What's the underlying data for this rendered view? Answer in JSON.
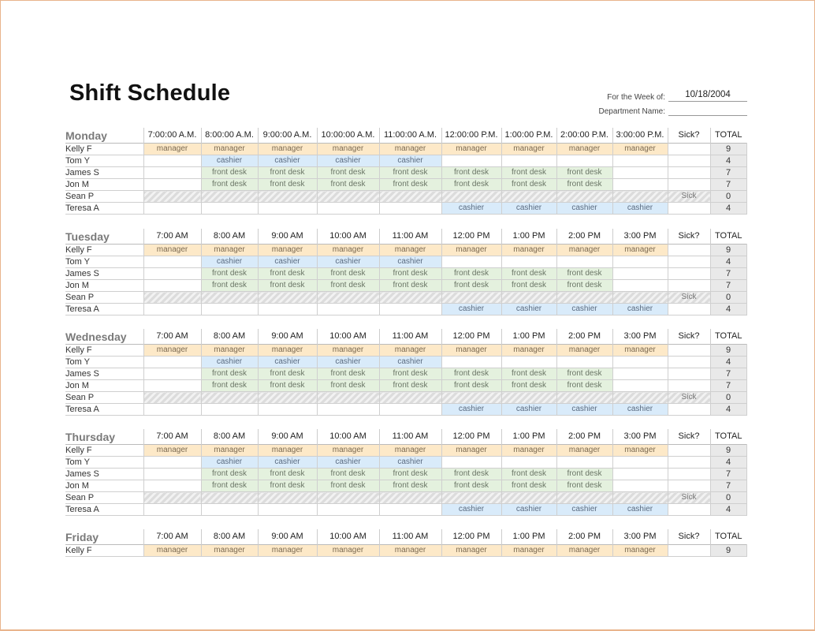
{
  "title": "Shift Schedule",
  "meta": {
    "week_label": "For the Week of:",
    "week_value": "10/18/2004",
    "department_label": "Department Name:",
    "department_value": ""
  },
  "colors": {
    "manager": "#fde9c8",
    "cashier": "#d9ebfa",
    "front_desk": "#e4f1de",
    "total": "#e9e9e9",
    "day_name": "#7a7a7a",
    "page_border": "#e9b48c"
  },
  "columns": {
    "sick": "Sick?",
    "total": "TOTAL"
  },
  "days": [
    {
      "name": "Monday",
      "times": [
        "7:00:00 A.M.",
        "8:00:00 A.M.",
        "9:00:00 A.M.",
        "10:00:00 A.M.",
        "11:00:00 A.M.",
        "12:00:00 P.M.",
        "1:00:00 P.M.",
        "2:00:00 P.M.",
        "3:00:00 P.M."
      ],
      "rows": [
        {
          "name": "Kelly F",
          "slots": [
            "manager",
            "manager",
            "manager",
            "manager",
            "manager",
            "manager",
            "manager",
            "manager",
            "manager"
          ],
          "sick": "",
          "total": "9"
        },
        {
          "name": "Tom Y",
          "slots": [
            "",
            "cashier",
            "cashier",
            "cashier",
            "cashier",
            "",
            "",
            "",
            ""
          ],
          "sick": "",
          "total": "4"
        },
        {
          "name": "James S",
          "slots": [
            "",
            "front desk",
            "front desk",
            "front desk",
            "front desk",
            "front desk",
            "front desk",
            "front desk",
            ""
          ],
          "sick": "",
          "total": "7"
        },
        {
          "name": "Jon M",
          "slots": [
            "",
            "front desk",
            "front desk",
            "front desk",
            "front desk",
            "front desk",
            "front desk",
            "front desk",
            ""
          ],
          "sick": "",
          "total": "7"
        },
        {
          "name": "Sean P",
          "slots": [
            "",
            "",
            "",
            "",
            "",
            "",
            "",
            "",
            ""
          ],
          "sick": "Sick",
          "total": "0",
          "hatched": true
        },
        {
          "name": "Teresa A",
          "slots": [
            "",
            "",
            "",
            "",
            "",
            "cashier",
            "cashier",
            "cashier",
            "cashier"
          ],
          "sick": "",
          "total": "4"
        }
      ]
    },
    {
      "name": "Tuesday",
      "times": [
        "7:00 AM",
        "8:00 AM",
        "9:00 AM",
        "10:00 AM",
        "11:00 AM",
        "12:00 PM",
        "1:00 PM",
        "2:00 PM",
        "3:00 PM"
      ],
      "rows": [
        {
          "name": "Kelly F",
          "slots": [
            "manager",
            "manager",
            "manager",
            "manager",
            "manager",
            "manager",
            "manager",
            "manager",
            "manager"
          ],
          "sick": "",
          "total": "9"
        },
        {
          "name": "Tom Y",
          "slots": [
            "",
            "cashier",
            "cashier",
            "cashier",
            "cashier",
            "",
            "",
            "",
            ""
          ],
          "sick": "",
          "total": "4"
        },
        {
          "name": "James S",
          "slots": [
            "",
            "front desk",
            "front desk",
            "front desk",
            "front desk",
            "front desk",
            "front desk",
            "front desk",
            ""
          ],
          "sick": "",
          "total": "7"
        },
        {
          "name": "Jon M",
          "slots": [
            "",
            "front desk",
            "front desk",
            "front desk",
            "front desk",
            "front desk",
            "front desk",
            "front desk",
            ""
          ],
          "sick": "",
          "total": "7"
        },
        {
          "name": "Sean P",
          "slots": [
            "",
            "",
            "",
            "",
            "",
            "",
            "",
            "",
            ""
          ],
          "sick": "Sick",
          "total": "0",
          "hatched": true
        },
        {
          "name": "Teresa A",
          "slots": [
            "",
            "",
            "",
            "",
            "",
            "cashier",
            "cashier",
            "cashier",
            "cashier"
          ],
          "sick": "",
          "total": "4"
        }
      ]
    },
    {
      "name": "Wednesday",
      "times": [
        "7:00 AM",
        "8:00 AM",
        "9:00 AM",
        "10:00 AM",
        "11:00 AM",
        "12:00 PM",
        "1:00 PM",
        "2:00 PM",
        "3:00 PM"
      ],
      "rows": [
        {
          "name": "Kelly F",
          "slots": [
            "manager",
            "manager",
            "manager",
            "manager",
            "manager",
            "manager",
            "manager",
            "manager",
            "manager"
          ],
          "sick": "",
          "total": "9"
        },
        {
          "name": "Tom Y",
          "slots": [
            "",
            "cashier",
            "cashier",
            "cashier",
            "cashier",
            "",
            "",
            "",
            ""
          ],
          "sick": "",
          "total": "4"
        },
        {
          "name": "James S",
          "slots": [
            "",
            "front desk",
            "front desk",
            "front desk",
            "front desk",
            "front desk",
            "front desk",
            "front desk",
            ""
          ],
          "sick": "",
          "total": "7"
        },
        {
          "name": "Jon M",
          "slots": [
            "",
            "front desk",
            "front desk",
            "front desk",
            "front desk",
            "front desk",
            "front desk",
            "front desk",
            ""
          ],
          "sick": "",
          "total": "7"
        },
        {
          "name": "Sean P",
          "slots": [
            "",
            "",
            "",
            "",
            "",
            "",
            "",
            "",
            ""
          ],
          "sick": "Sick",
          "total": "0",
          "hatched": true
        },
        {
          "name": "Teresa A",
          "slots": [
            "",
            "",
            "",
            "",
            "",
            "cashier",
            "cashier",
            "cashier",
            "cashier"
          ],
          "sick": "",
          "total": "4"
        }
      ]
    },
    {
      "name": "Thursday",
      "times": [
        "7:00 AM",
        "8:00 AM",
        "9:00 AM",
        "10:00 AM",
        "11:00 AM",
        "12:00 PM",
        "1:00 PM",
        "2:00 PM",
        "3:00 PM"
      ],
      "rows": [
        {
          "name": "Kelly F",
          "slots": [
            "manager",
            "manager",
            "manager",
            "manager",
            "manager",
            "manager",
            "manager",
            "manager",
            "manager"
          ],
          "sick": "",
          "total": "9"
        },
        {
          "name": "Tom Y",
          "slots": [
            "",
            "cashier",
            "cashier",
            "cashier",
            "cashier",
            "",
            "",
            "",
            ""
          ],
          "sick": "",
          "total": "4"
        },
        {
          "name": "James S",
          "slots": [
            "",
            "front desk",
            "front desk",
            "front desk",
            "front desk",
            "front desk",
            "front desk",
            "front desk",
            ""
          ],
          "sick": "",
          "total": "7"
        },
        {
          "name": "Jon M",
          "slots": [
            "",
            "front desk",
            "front desk",
            "front desk",
            "front desk",
            "front desk",
            "front desk",
            "front desk",
            ""
          ],
          "sick": "",
          "total": "7"
        },
        {
          "name": "Sean P",
          "slots": [
            "",
            "",
            "",
            "",
            "",
            "",
            "",
            "",
            ""
          ],
          "sick": "Sick",
          "total": "0",
          "hatched": true
        },
        {
          "name": "Teresa A",
          "slots": [
            "",
            "",
            "",
            "",
            "",
            "cashier",
            "cashier",
            "cashier",
            "cashier"
          ],
          "sick": "",
          "total": "4"
        }
      ]
    },
    {
      "name": "Friday",
      "times": [
        "7:00 AM",
        "8:00 AM",
        "9:00 AM",
        "10:00 AM",
        "11:00 AM",
        "12:00 PM",
        "1:00 PM",
        "2:00 PM",
        "3:00 PM"
      ],
      "rows": [
        {
          "name": "Kelly F",
          "slots": [
            "manager",
            "manager",
            "manager",
            "manager",
            "manager",
            "manager",
            "manager",
            "manager",
            "manager"
          ],
          "sick": "",
          "total": "9"
        }
      ]
    }
  ]
}
